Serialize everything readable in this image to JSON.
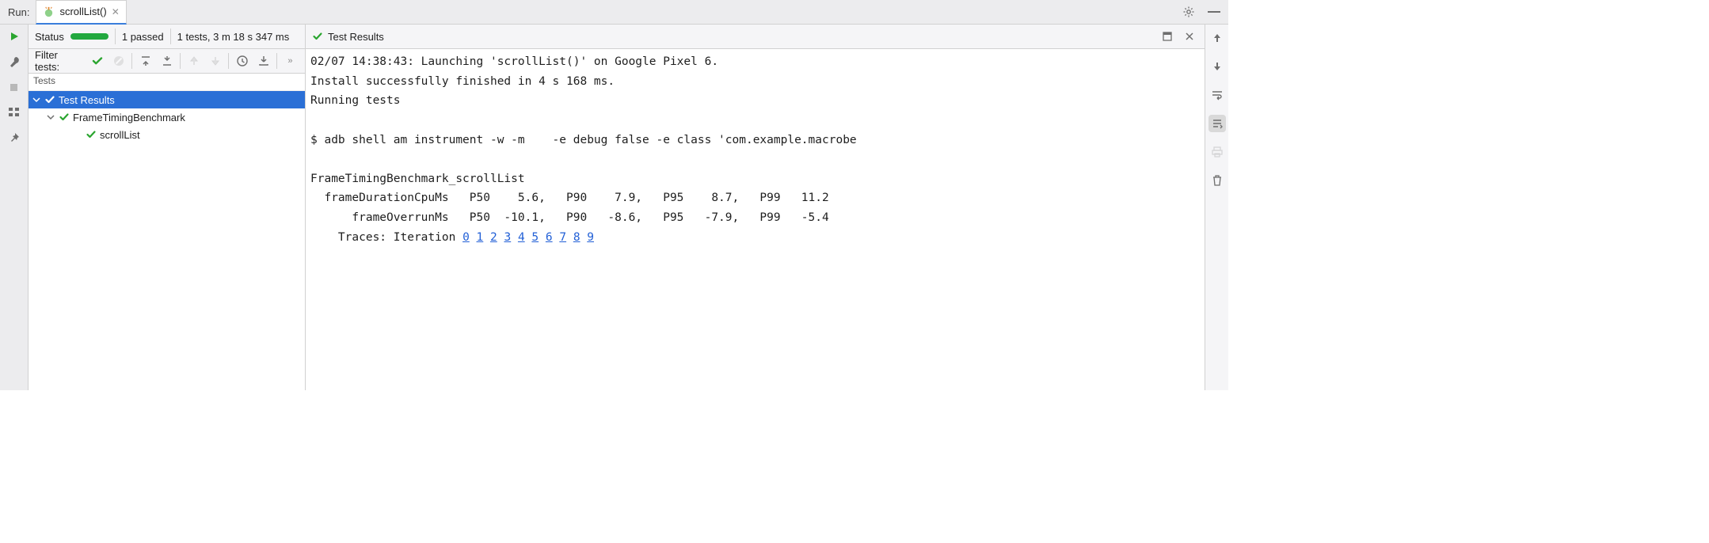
{
  "tabbar": {
    "run_label": "Run:",
    "tab_name": "scrollList()"
  },
  "status": {
    "label": "Status",
    "passed": "1 passed",
    "summary": "1 tests, 3 m 18 s 347 ms"
  },
  "filter": {
    "label": "Filter tests:"
  },
  "tree": {
    "header": "Tests",
    "root": "Test Results",
    "node1": "FrameTimingBenchmark",
    "node2": "scrollList"
  },
  "resultbar": {
    "title": "Test Results"
  },
  "console": {
    "lines": [
      "02/07 14:38:43: Launching 'scrollList()' on Google Pixel 6.",
      "Install successfully finished in 4 s 168 ms.",
      "Running tests",
      "",
      "$ adb shell am instrument -w -m    -e debug false -e class 'com.example.macrobe",
      "",
      "FrameTimingBenchmark_scrollList",
      "  frameDurationCpuMs   P50    5.6,   P90    7.9,   P95    8.7,   P99   11.2",
      "      frameOverrunMs   P50  -10.1,   P90   -8.6,   P95   -7.9,   P99   -5.4",
      "    Traces: Iteration "
    ],
    "trace_links": [
      "0",
      "1",
      "2",
      "3",
      "4",
      "5",
      "6",
      "7",
      "8",
      "9"
    ]
  },
  "icons": {
    "run": "run-icon",
    "wrench": "wrench-icon",
    "stop": "stop-icon",
    "layout": "layout-icon",
    "pin": "pin-icon",
    "gear": "gear-icon",
    "minimize": "minimize-icon",
    "close": "close-tab-icon",
    "check": "check-ok-icon",
    "cancel": "cancel-icon",
    "collapse": "collapse-icon",
    "expand": "expand-icon",
    "up": "arrow-up-icon",
    "down": "arrow-down-icon",
    "history": "history-icon",
    "import": "import-icon",
    "more": "more-icon",
    "soft": "softwrap-icon",
    "scroll": "scroll-end-icon",
    "print": "print-icon",
    "trash": "trash-icon",
    "max": "maximize-panel-icon",
    "x": "close-panel-icon",
    "caret": "jump-caret-icon"
  }
}
